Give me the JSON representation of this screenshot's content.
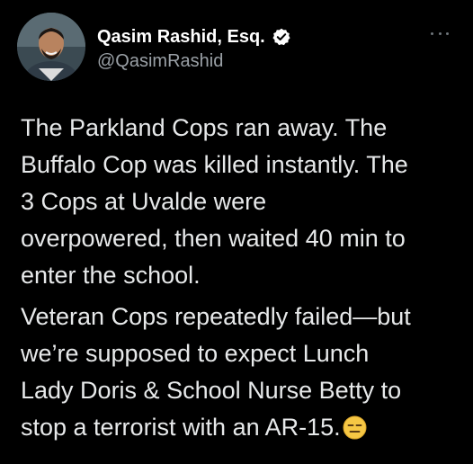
{
  "author": {
    "display_name": "Qasim Rashid, Esq.",
    "handle": "@QasimRashid",
    "verified": true,
    "avatar_icon": "profile-photo"
  },
  "menu": {
    "icon": "more-horizontal-icon"
  },
  "tweet": {
    "paragraph_1": "The Parkland Cops ran away. The\nBuffalo Cop was killed instantly. The\n3 Cops at Uvalde were\noverpowered, then waited 40 min to\nenter the school.",
    "paragraph_2": "Veteran Cops repeatedly failed—but\nwe’re supposed to expect Lunch\nLady Doris & School Nurse Betty to\nstop a terrorist with an AR-15.",
    "emoji": "expressionless-face"
  },
  "colors": {
    "background": "#000000",
    "text": "#e7e9ea",
    "secondary_text": "#9aa0a6",
    "verified_badge": "#ffffff",
    "emoji_yellow": "#f6c744"
  }
}
